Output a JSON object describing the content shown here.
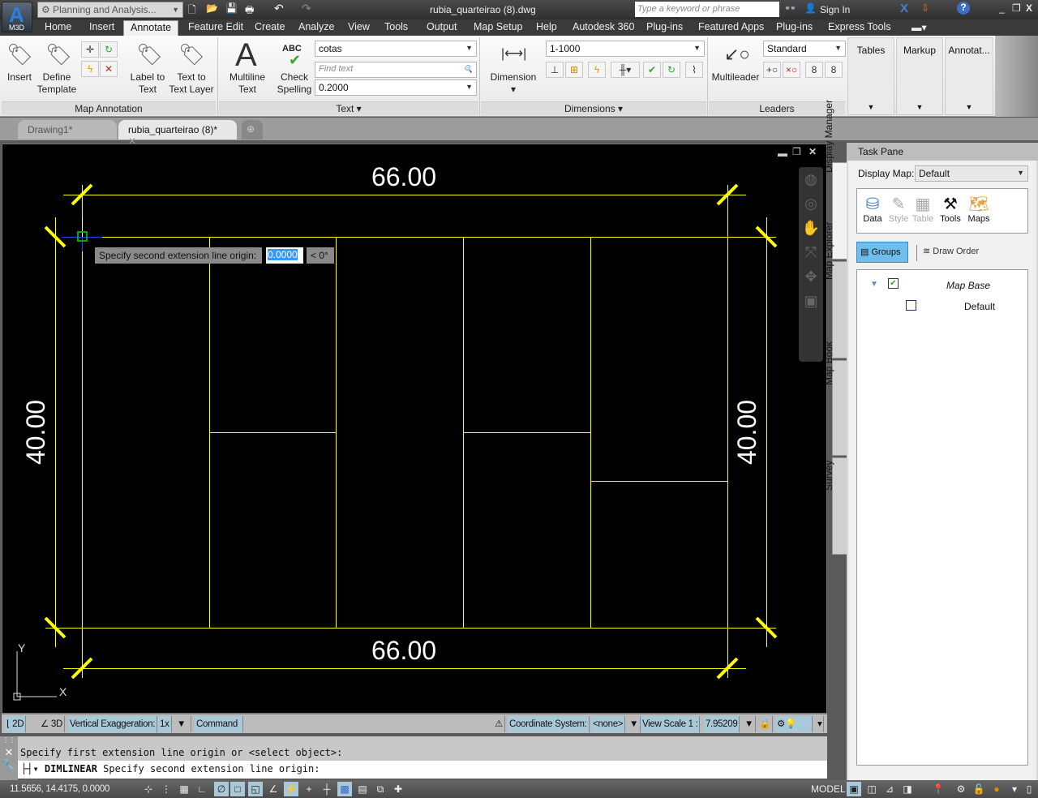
{
  "app": {
    "badge": "M3D",
    "workspace": "Planning and Analysis...",
    "file_title": "rubia_quarteirao (8).dwg",
    "search_placeholder": "Type a keyword or phrase",
    "sign_in": "Sign In"
  },
  "menu_tabs": [
    "Home",
    "Insert",
    "Annotate",
    "Feature Edit",
    "Create",
    "Analyze",
    "View",
    "Tools",
    "Output",
    "Map Setup",
    "Help",
    "Autodesk 360",
    "Plug-ins",
    "Featured Apps",
    "Plug-ins",
    "Express Tools"
  ],
  "active_tab": "Annotate",
  "ribbon": {
    "map_annotation": {
      "title": "Map Annotation",
      "insert": "Insert",
      "define_template": [
        "Define",
        "Template"
      ],
      "label_to_text": [
        "Label to",
        "Text"
      ],
      "text_to_text_layer": [
        "Text to",
        "Text Layer"
      ]
    },
    "text": {
      "title": "Text",
      "multiline": [
        "Multiline",
        "Text"
      ],
      "check_spelling": [
        "Check",
        "Spelling"
      ],
      "abc": "ABC",
      "style_value": "cotas",
      "find_placeholder": "Find text",
      "height_value": "0.2000"
    },
    "dimensions": {
      "title": "Dimensions",
      "dimension": "Dimension",
      "style_value": "1-1000"
    },
    "leaders": {
      "title": "Leaders",
      "multileader": "Multileader",
      "style_value": "Standard"
    },
    "tables": "Tables",
    "markup": "Markup",
    "annotation": "Annotat..."
  },
  "doc_tabs": [
    {
      "label": "Drawing1*"
    },
    {
      "label": "rubia_quarteirao (8)*",
      "active": true
    }
  ],
  "drawing": {
    "dim_top": "66.00",
    "dim_bottom": "66.00",
    "dim_left": "40.00",
    "dim_right": "40.00",
    "prompt": "Specify second extension line origin:",
    "prompt_value": "0.0000",
    "prompt_angle": "< 0°",
    "ucs_y": "Y",
    "ucs_x": "X"
  },
  "viewport_status": {
    "2d": "2D",
    "3d": "3D",
    "vert_exag_label": "Vertical Exaggeration:",
    "vert_exag_value": "1x",
    "command": "Command",
    "coord_sys_label": "Coordinate System:",
    "coord_sys_value": "<none>",
    "view_scale_label": "View Scale  1 :",
    "view_scale_value": "7.95209"
  },
  "command_line": {
    "history": "Specify first extension line origin or <select object>:",
    "command": "DIMLINEAR",
    "current": "Specify second extension line origin:"
  },
  "status_bar": {
    "coords": "11.5656, 14.4175, 0.0000",
    "model": "MODEL"
  },
  "task_pane": {
    "title": "Task Pane",
    "display_map_label": "Display Map:",
    "display_map_value": "Default",
    "tools": [
      "Data",
      "Style",
      "Table",
      "Tools",
      "Maps"
    ],
    "groups": "Groups",
    "draw_order": "Draw Order",
    "tree": [
      {
        "label": "Map Base",
        "checked": true
      },
      {
        "label": "Default",
        "checked": false
      }
    ],
    "side_tabs": [
      "Display Manager",
      "Map Explorer",
      "Map Book",
      "Survey"
    ]
  },
  "colors": {
    "drawing_line": "#ffff00",
    "canvas": "#000000",
    "selection": "#3399ff",
    "accent": "#a9c8d8"
  }
}
